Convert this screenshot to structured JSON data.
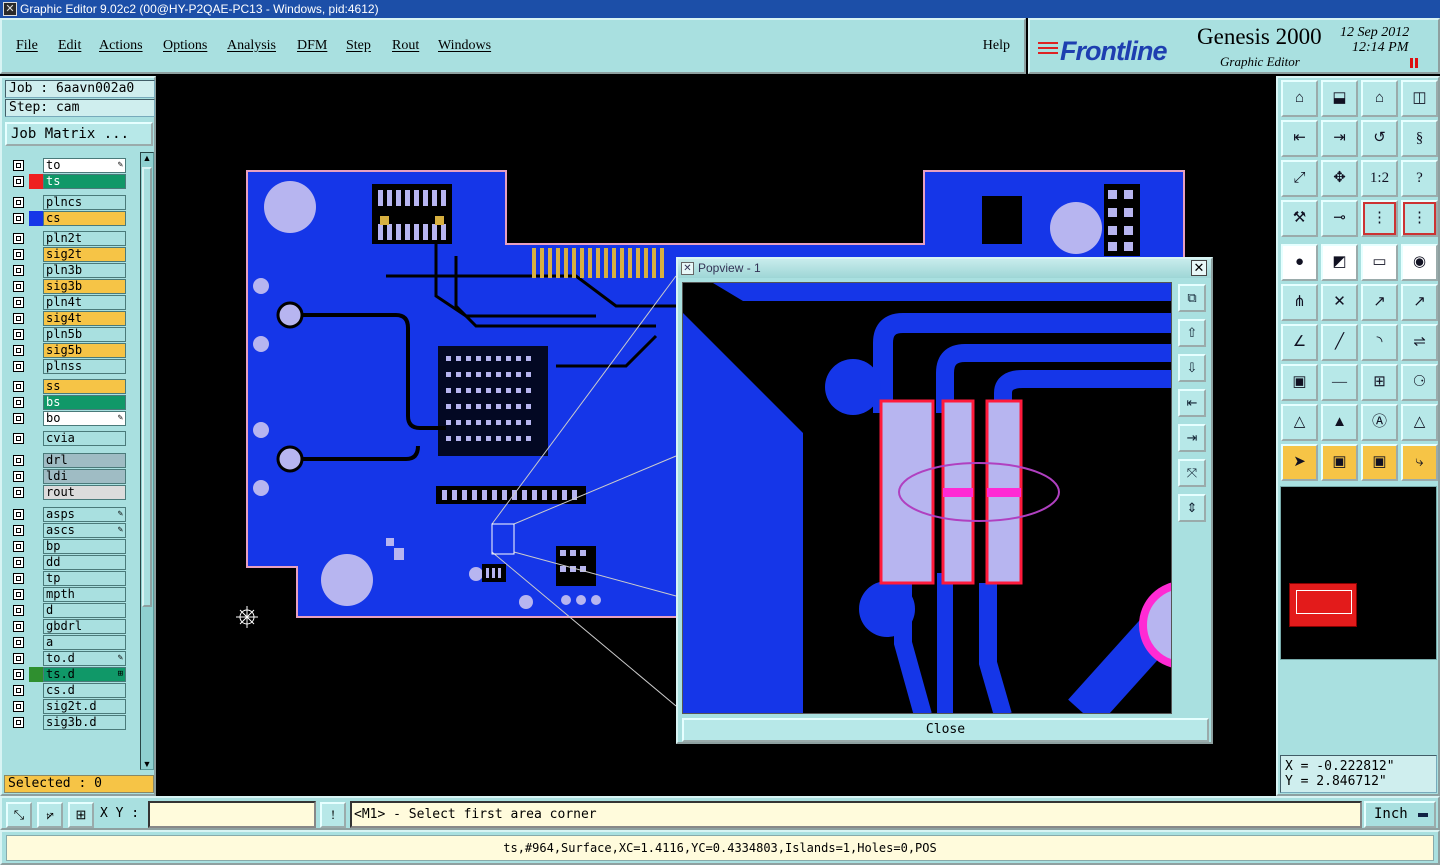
{
  "window": {
    "title": "Graphic Editor 9.02c2 (00@HY-P2QAE-PC13 - Windows, pid:4612)"
  },
  "menu": {
    "items": [
      "File",
      "Edit",
      "Actions",
      "Options",
      "Analysis",
      "DFM",
      "Step",
      "Rout",
      "Windows"
    ],
    "help": "Help"
  },
  "brand": {
    "logo": "Frontline",
    "product": "Genesis 2000",
    "subtitle": "Graphic Editor",
    "date": "12 Sep 2012",
    "time": "12:14 PM"
  },
  "job": {
    "job_label": "Job : 6aavn002a0",
    "step_label": "Step: cam",
    "matrix_button": "Job Matrix ..."
  },
  "layers": [
    {
      "name": "to",
      "color": "#ffffff",
      "mark": "edit"
    },
    {
      "name": "ts",
      "color": "#109868",
      "swatch": "#ee2020",
      "text": "#ffffff"
    },
    {
      "name": "plncs",
      "color": "#a9e0e0"
    },
    {
      "name": "cs",
      "color": "#f6c446",
      "swatch": "#1536e8"
    },
    {
      "name": "pln2t",
      "color": "#a9e0e0"
    },
    {
      "name": "sig2t",
      "color": "#f6c446"
    },
    {
      "name": "pln3b",
      "color": "#a9e0e0"
    },
    {
      "name": "sig3b",
      "color": "#f6c446"
    },
    {
      "name": "pln4t",
      "color": "#a9e0e0"
    },
    {
      "name": "sig4t",
      "color": "#f6c446"
    },
    {
      "name": "pln5b",
      "color": "#a9e0e0"
    },
    {
      "name": "sig5b",
      "color": "#f6c446"
    },
    {
      "name": "plnss",
      "color": "#a9e0e0"
    },
    {
      "name": "ss",
      "color": "#f6c446"
    },
    {
      "name": "bs",
      "color": "#109868",
      "text": "#ffffff"
    },
    {
      "name": "bo",
      "color": "#ffffff",
      "mark": "edit"
    },
    {
      "name": "cvia",
      "color": "#a9e0e0"
    },
    {
      "name": "drl",
      "color": "#9fbcc4"
    },
    {
      "name": "ldi",
      "color": "#9fbcc4"
    },
    {
      "name": "rout",
      "color": "#dcdcdc"
    },
    {
      "name": "asps",
      "color": "#a9e0e0",
      "mark": "edit"
    },
    {
      "name": "ascs",
      "color": "#a9e0e0",
      "mark": "edit"
    },
    {
      "name": "bp",
      "color": "#a9e0e0"
    },
    {
      "name": "dd",
      "color": "#a9e0e0"
    },
    {
      "name": "tp",
      "color": "#a9e0e0"
    },
    {
      "name": "mpth",
      "color": "#a9e0e0"
    },
    {
      "name": "d",
      "color": "#a9e0e0"
    },
    {
      "name": "gbdrl",
      "color": "#a9e0e0"
    },
    {
      "name": "a",
      "color": "#a9e0e0"
    },
    {
      "name": "to.d",
      "color": "#a9e0e0",
      "mark": "edit"
    },
    {
      "name": "ts.d",
      "color": "#109868",
      "swatch": "#2f8f2f",
      "mark": "grid"
    },
    {
      "name": "cs.d",
      "color": "#a9e0e0"
    },
    {
      "name": "sig2t.d",
      "color": "#a9e0e0"
    },
    {
      "name": "sig3b.d",
      "color": "#a9e0e0"
    }
  ],
  "selected": "Selected : 0",
  "popview": {
    "title": "Popview - 1",
    "close": "Close",
    "tools": [
      "zoom-fit-icon",
      "zoom-in-icon",
      "zoom-out-icon",
      "pan-left-icon",
      "pan-right-icon",
      "expand-icon",
      "contract-icon"
    ]
  },
  "right_tools": [
    [
      "home-up-icon",
      "home-down-icon",
      "home-icon",
      "window-split-icon"
    ],
    [
      "pan-left-icon",
      "pan-right-icon",
      "rotate-icon",
      "mirror-icon"
    ],
    [
      "fit-icon",
      "center-icon",
      "scale-icon",
      "help-icon"
    ],
    [
      "measure-icon",
      "probe-icon",
      "layer-compare-icon",
      "layer-compare-red-icon"
    ],
    [
      "pad-icon",
      "surface-icon",
      "ruler-icon",
      "circle-icon"
    ],
    [
      "connect-icon",
      "delete-icon",
      "move-icon",
      "copy-icon"
    ],
    [
      "angle-icon",
      "line-icon",
      "arc-icon",
      "flip-icon"
    ],
    [
      "snap-icon",
      "split-icon",
      "grid-icon",
      "group-icon"
    ],
    [
      "polygon-icon",
      "fill-icon",
      "outline-icon",
      "contour-icon"
    ],
    [
      "pointer-icon",
      "select-icon",
      "select-area-icon",
      "route-icon"
    ]
  ],
  "coords": {
    "x": "X = -0.222812\"",
    "y": "Y = 2.846712\""
  },
  "command": {
    "xy_label": "X Y :",
    "xy_value": "",
    "prompt": "<M1> - Select first area corner",
    "units": "Inch"
  },
  "status": "ts,#964,Surface,XC=1.4116,YC=0.4334803,Islands=1,Holes=0,POS",
  "colors": {
    "board": "#1536e8",
    "pad": "#b7b5f0",
    "highlight": "#ff2ad4",
    "panel": "#a9e0e0",
    "layer_signal": "#f6c446"
  }
}
